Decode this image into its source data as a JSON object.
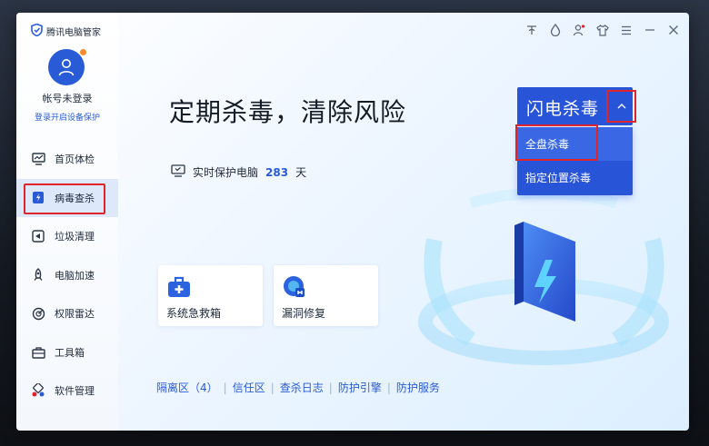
{
  "app": {
    "title": "腾讯电脑管家"
  },
  "account": {
    "name": "帐号未登录",
    "login_link": "登录开启设备保护"
  },
  "sidebar": {
    "items": [
      {
        "label": "首页体检",
        "icon": "monitor-icon"
      },
      {
        "label": "病毒查杀",
        "icon": "lightning-shield-icon",
        "active": true
      },
      {
        "label": "垃圾清理",
        "icon": "broom-icon"
      },
      {
        "label": "电脑加速",
        "icon": "rocket-icon"
      },
      {
        "label": "权限雷达",
        "icon": "radar-icon"
      },
      {
        "label": "工具箱",
        "icon": "toolbox-icon"
      },
      {
        "label": "软件管理",
        "icon": "apps-icon"
      }
    ]
  },
  "main": {
    "headline": "定期杀毒，清除风险",
    "protect_label": "实时保护电脑",
    "protect_days": "283",
    "protect_unit": "天",
    "scan_button": "闪电杀毒",
    "dropdown": [
      "全盘杀毒",
      "指定位置杀毒"
    ],
    "tools": [
      {
        "label": "系统急救箱",
        "icon": "first-aid-kit-icon"
      },
      {
        "label": "漏洞修复",
        "icon": "bug-patch-icon"
      }
    ],
    "links": [
      "隔离区（4）",
      "信任区",
      "查杀日志",
      "防护引擎",
      "防护服务"
    ]
  },
  "colors": {
    "accent": "#2854d8",
    "highlight": "#e0242b"
  }
}
